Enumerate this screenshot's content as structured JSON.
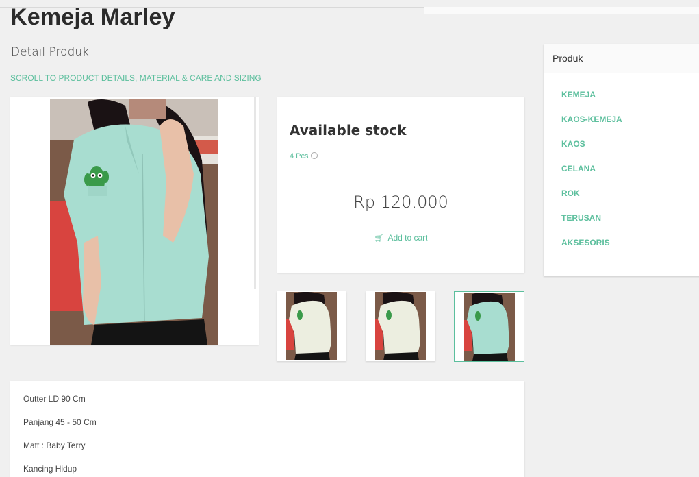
{
  "page": {
    "title": "Kemeja Marley",
    "subtitle": "Detail Produk",
    "scroll_link": "SCROLL TO PRODUCT DETAILS, MATERIAL & CARE AND SIZING"
  },
  "stock": {
    "title": "Available stock",
    "quantity": "4 Pcs",
    "price": "Rp 120.000",
    "add_to_cart": "Add to cart"
  },
  "description": {
    "lines": [
      "Outter LD 90 Cm",
      "Panjang 45 - 50 Cm",
      "Matt : Baby Terry",
      "Kancing Hidup"
    ]
  },
  "sidebar": {
    "title": "Produk",
    "categories": [
      "KEMEJA",
      "KAOS-KEMEJA",
      "KAOS",
      "CELANA",
      "ROK",
      "TERUSAN",
      "AKSESORIS"
    ]
  },
  "icons": {
    "cart": "shopping-cart-icon",
    "info": "info-circle-icon"
  },
  "colors": {
    "accent": "#5cbf9d",
    "shirt": "#a8ddd0",
    "shirt_white": "#eceee0",
    "background": "#f0f0f0"
  }
}
